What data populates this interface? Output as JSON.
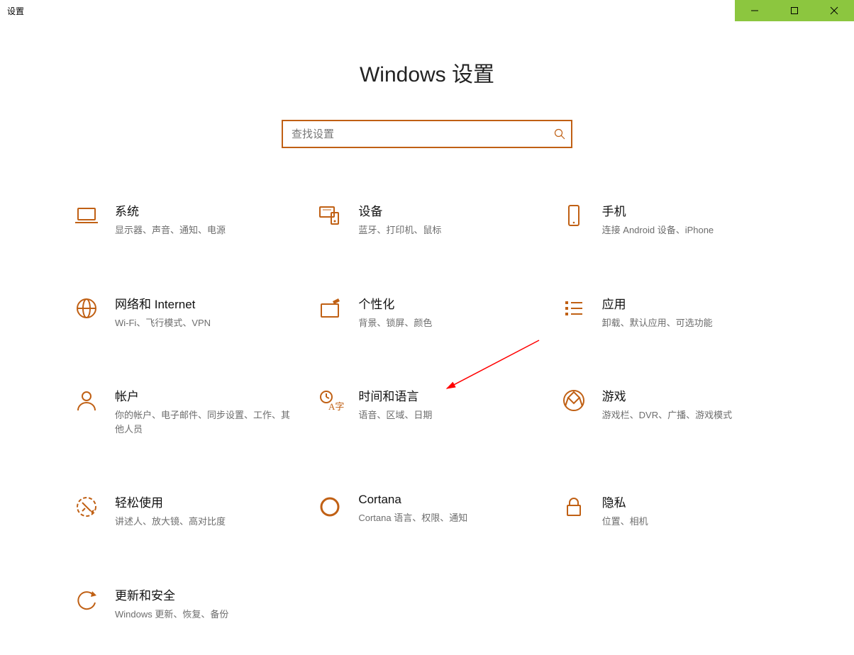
{
  "window": {
    "title": "设置"
  },
  "page": {
    "heading": "Windows 设置"
  },
  "search": {
    "placeholder": "查找设置"
  },
  "tiles": [
    {
      "id": "system",
      "title": "系统",
      "sub": "显示器、声音、通知、电源"
    },
    {
      "id": "devices",
      "title": "设备",
      "sub": "蓝牙、打印机、鼠标"
    },
    {
      "id": "phone",
      "title": "手机",
      "sub": "连接 Android 设备、iPhone"
    },
    {
      "id": "network",
      "title": "网络和 Internet",
      "sub": "Wi-Fi、飞行模式、VPN"
    },
    {
      "id": "personalize",
      "title": "个性化",
      "sub": "背景、锁屏、颜色"
    },
    {
      "id": "apps",
      "title": "应用",
      "sub": "卸载、默认应用、可选功能"
    },
    {
      "id": "accounts",
      "title": "帐户",
      "sub": "你的帐户、电子邮件、同步设置、工作、其他人员"
    },
    {
      "id": "time-language",
      "title": "时间和语言",
      "sub": "语音、区域、日期"
    },
    {
      "id": "gaming",
      "title": "游戏",
      "sub": "游戏栏、DVR、广播、游戏模式"
    },
    {
      "id": "ease",
      "title": "轻松使用",
      "sub": "讲述人、放大镜、高对比度"
    },
    {
      "id": "cortana",
      "title": "Cortana",
      "sub": "Cortana 语言、权限、通知"
    },
    {
      "id": "privacy",
      "title": "隐私",
      "sub": "位置、相机"
    },
    {
      "id": "update",
      "title": "更新和安全",
      "sub": "Windows 更新、恢复、备份"
    }
  ],
  "colors": {
    "accent": "#c06014",
    "titlebar_btn": "#8cc63f"
  }
}
